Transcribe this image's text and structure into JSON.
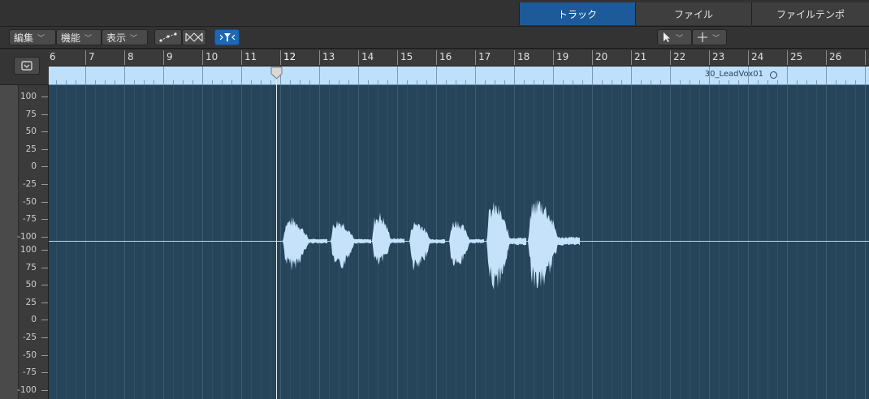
{
  "tabs": [
    {
      "label": "トラック",
      "active": true
    },
    {
      "label": "ファイル",
      "active": false
    },
    {
      "label": "ファイルテンポ",
      "active": false
    }
  ],
  "toolbar": {
    "menus": [
      "編集",
      "機能",
      "表示"
    ],
    "pointer_tool_icon": "arrow-pointer-icon",
    "secondary_tool_icon": "crosshair-icon",
    "icons": [
      "curve-points-icon",
      "crossfade-icon",
      "flex-filter-icon"
    ]
  },
  "ruler": {
    "bars": [
      "6",
      "7",
      "8",
      "9",
      "10",
      "11",
      "12",
      "13",
      "14",
      "15",
      "16",
      "17",
      "18",
      "19",
      "20",
      "21",
      "22",
      "23",
      "24",
      "25",
      "26",
      "2"
    ],
    "region_name": "30_LeadVox01"
  },
  "y_axis": {
    "top_labels": [
      "100",
      "75",
      "50",
      "25",
      "0",
      "-25",
      "-50",
      "-75",
      "-100"
    ],
    "bottom_labels": [
      "100",
      "75",
      "50",
      "25",
      "0",
      "-25",
      "-50",
      "-75",
      "-100"
    ]
  },
  "colors": {
    "accent": "#1c5a9a",
    "waveform": "#c6e2fb",
    "background": "#26455a",
    "region_strip": "#bfe0fa"
  },
  "playhead_bar": "12"
}
